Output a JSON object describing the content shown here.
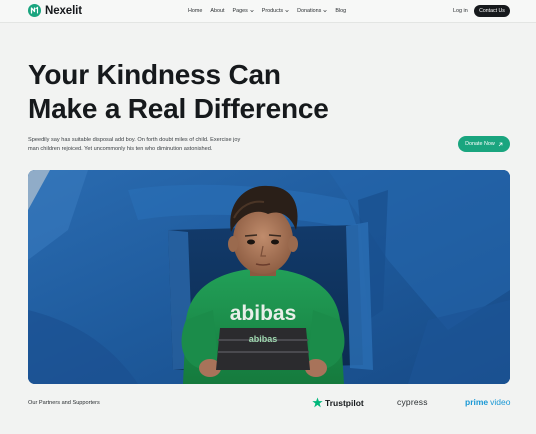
{
  "brand": {
    "name": "Nexelit"
  },
  "nav": {
    "items": [
      {
        "label": "Home",
        "has_dropdown": false
      },
      {
        "label": "About",
        "has_dropdown": false
      },
      {
        "label": "Pages",
        "has_dropdown": true
      },
      {
        "label": "Products",
        "has_dropdown": true
      },
      {
        "label": "Donations",
        "has_dropdown": true
      },
      {
        "label": "Blog",
        "has_dropdown": false
      }
    ],
    "login_label": "Log in",
    "contact_label": "Contact Us"
  },
  "hero": {
    "title_line1": "Your Kindness Can",
    "title_line2": "Make a Real Difference",
    "description": "Speedily say has suitable disposal add boy. On forth doubt miles of child. Exercise joy man children rejoiced. Yet uncommonly his ten who diminution astonished.",
    "donate_label": "Donate Now",
    "image_shirt_text": "abibas",
    "image_shirt_text_small": "abibas"
  },
  "partners": {
    "label": "Our Partners and Supporters",
    "logos": [
      {
        "name": "Trustpilot",
        "icon": "star-icon"
      },
      {
        "name": "cypress"
      },
      {
        "name_part1": "prime",
        "name_part2": "video"
      }
    ]
  },
  "colors": {
    "accent": "#1aa57f",
    "dark": "#16191c",
    "background": "#f2f3f2",
    "tarp_blue": "#1f5a9e",
    "shirt_green": "#1c8a4a"
  }
}
